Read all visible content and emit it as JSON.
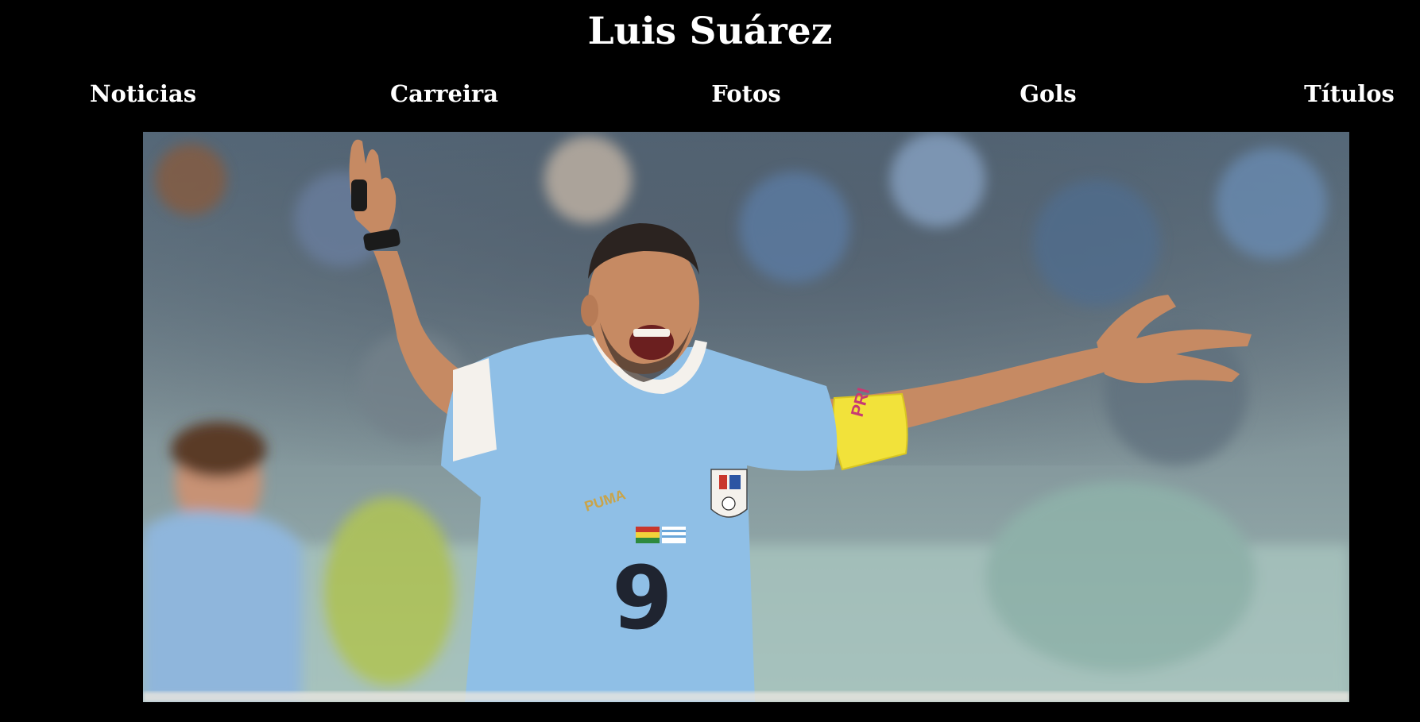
{
  "header": {
    "title": "Luis Suárez"
  },
  "nav": {
    "items": [
      {
        "label": "Noticias"
      },
      {
        "label": "Carreira"
      },
      {
        "label": "Fotos"
      },
      {
        "label": "Gols"
      },
      {
        "label": "Títulos"
      }
    ]
  },
  "hero": {
    "jersey_number": "9",
    "colors": {
      "jersey": "#8fbfe6",
      "armband": "#f2e23a",
      "background": "#000000"
    }
  }
}
